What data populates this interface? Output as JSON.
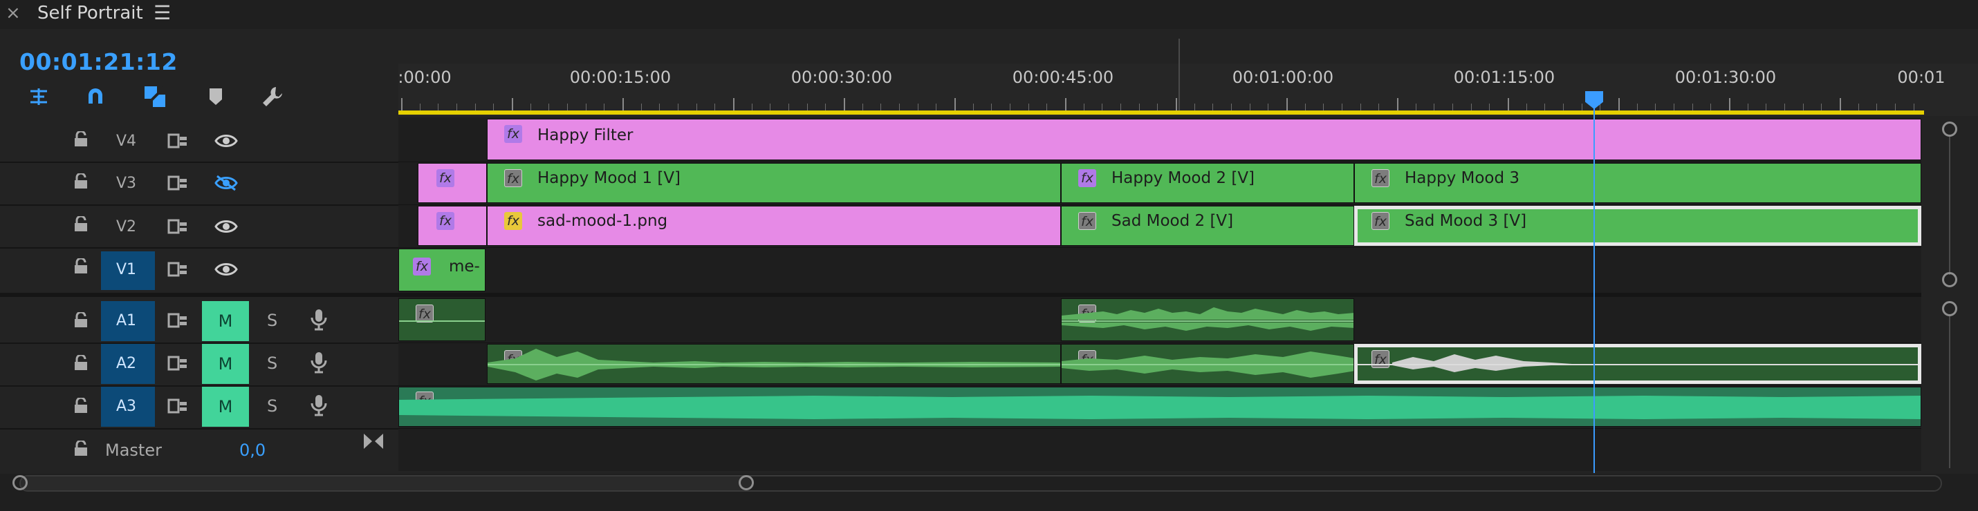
{
  "tab": {
    "close_icon": "×",
    "title": "Self Portrait",
    "menu_icon": "☰"
  },
  "timecode": "00:01:21:12",
  "tools": [
    "snap-insert-icon",
    "magnet-icon",
    "linked-selection-icon",
    "add-marker-icon",
    "wrench-icon"
  ],
  "ruler": {
    "labels": [
      ":00:00",
      "00:00:15:00",
      "00:00:30:00",
      "00:00:45:00",
      "00:01:00:00",
      "00:01:15:00",
      "00:01:30:00",
      "00:01"
    ]
  },
  "tracks": {
    "video": [
      {
        "name": "V4",
        "eye": "visible"
      },
      {
        "name": "V3",
        "eye": "hidden"
      },
      {
        "name": "V2",
        "eye": "visible"
      },
      {
        "name": "V1",
        "eye": "visible"
      }
    ],
    "audio": [
      {
        "name": "A1",
        "mute": "M",
        "solo": "S"
      },
      {
        "name": "A2",
        "mute": "M",
        "solo": "S"
      },
      {
        "name": "A3",
        "mute": "M",
        "solo": "S"
      }
    ],
    "master": {
      "label": "Master",
      "value": "0,0"
    }
  },
  "clips": {
    "happy_filter": "Happy Filter",
    "happy_mood_1": "Happy Mood 1 [V]",
    "happy_mood_2": "Happy Mood 2 [V]",
    "happy_mood_3": "Happy Mood 3",
    "sad_mood_png": "sad-mood-1.png",
    "sad_mood_2": "Sad Mood 2 [V]",
    "sad_mood_3": "Sad Mood 3 [V]",
    "v1_clip": "me-",
    "fx": "fx"
  },
  "colors": {
    "accent": "#3aa0ff",
    "pink_clip": "#e68ae6",
    "green_clip": "#51b856",
    "audio_clip": "#2b5c30",
    "mute_on": "#42d49a",
    "work_area": "#e5d000"
  }
}
